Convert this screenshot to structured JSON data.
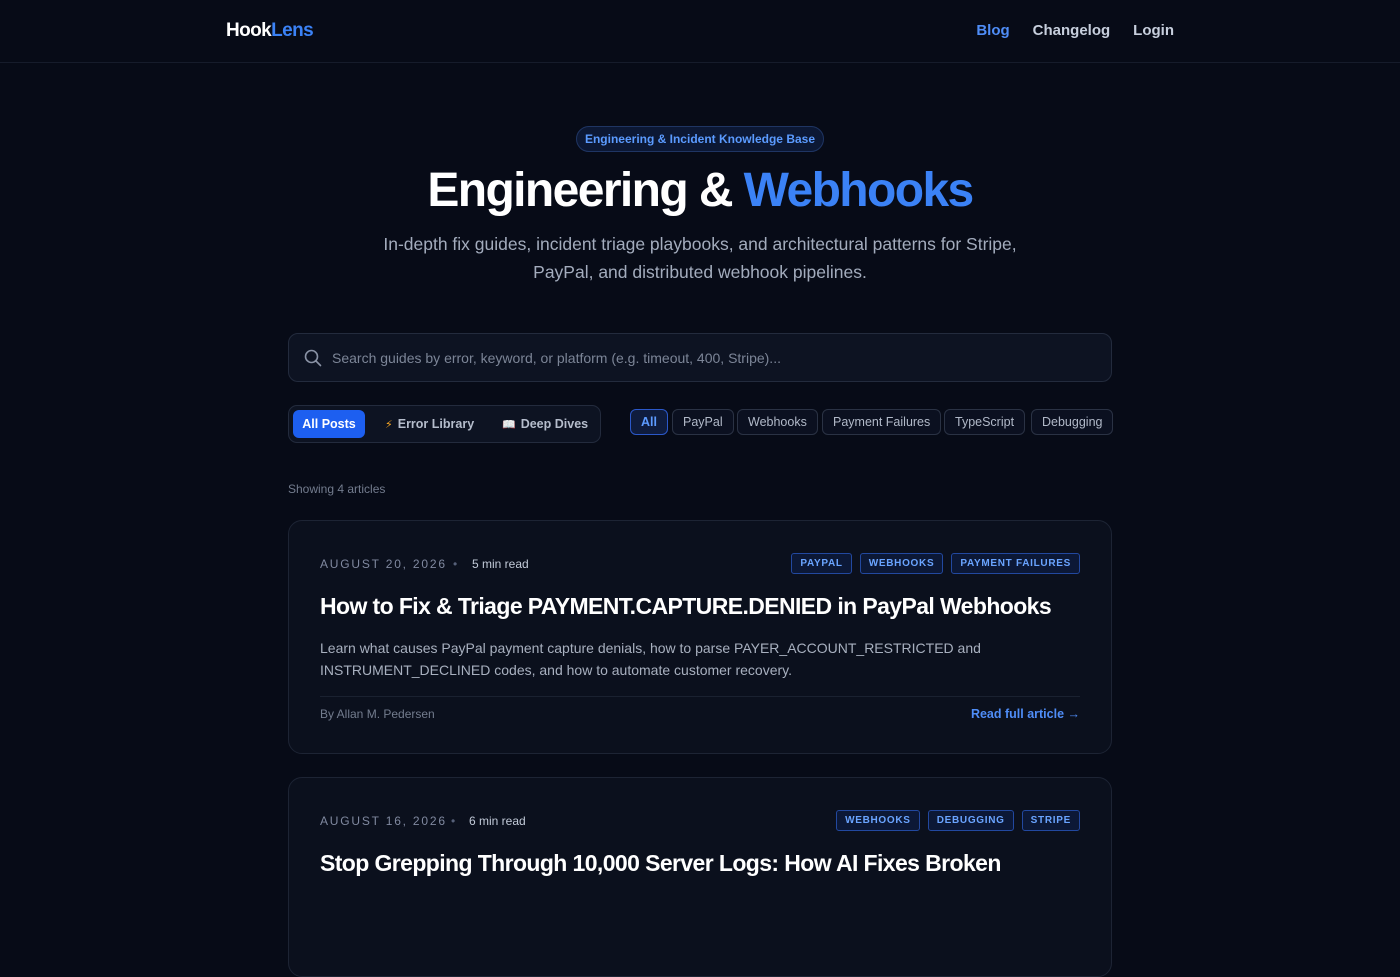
{
  "header": {
    "logo_part1": "Hook",
    "logo_part2": "Lens",
    "nav": {
      "blog": "Blog",
      "changelog": "Changelog",
      "login": "Login"
    }
  },
  "hero": {
    "badge": "Engineering & Incident Knowledge Base",
    "title_main": "Engineering &",
    "title_accent": "Webhooks",
    "subtitle": "In-depth fix guides, incident triage playbooks, and architectural patterns for Stripe, PayPal, and distributed webhook pipelines."
  },
  "search": {
    "placeholder": "Search guides by error, keyword, or platform (e.g. timeout, 400, Stripe)...",
    "value": ""
  },
  "segments": {
    "all_posts": "All Posts",
    "error_library": "Error Library",
    "deep_dives": "Deep Dives",
    "active": "All Posts"
  },
  "filters": {
    "all": "All",
    "paypal": "PayPal",
    "webhooks": "Webhooks",
    "payment_failures": "Payment Failures",
    "typescript": "TypeScript",
    "debugging": "Debugging",
    "active": "All"
  },
  "results_count": "Showing 4 articles",
  "articles": [
    {
      "date": "AUGUST 20, 2026",
      "read_time": "5 min read",
      "tags": [
        "PAYPAL",
        "WEBHOOKS",
        "PAYMENT FAILURES"
      ],
      "title": "How to Fix & Triage PAYMENT.CAPTURE.DENIED in PayPal Webhooks",
      "excerpt": "Learn what causes PayPal payment capture denials, how to parse PAYER_ACCOUNT_RESTRICTED and INSTRUMENT_DECLINED codes, and how to automate customer recovery.",
      "author": "By Allan M. Pedersen",
      "read_more": "Read full article →"
    },
    {
      "date": "AUGUST 16, 2026",
      "read_time": "6 min read",
      "tags": [
        "WEBHOOKS",
        "DEBUGGING",
        "STRIPE"
      ],
      "title": "Stop Grepping Through 10,000 Server Logs: How AI Fixes Broken"
    }
  ],
  "colors": {
    "background": "#070b17",
    "accent": "#3b82f6",
    "card_background": "#0b101d",
    "tag_text": "#6aa4ff"
  },
  "icons": {
    "search": "search-icon",
    "error_library": "lightning-icon",
    "deep_dives": "book-icon"
  }
}
